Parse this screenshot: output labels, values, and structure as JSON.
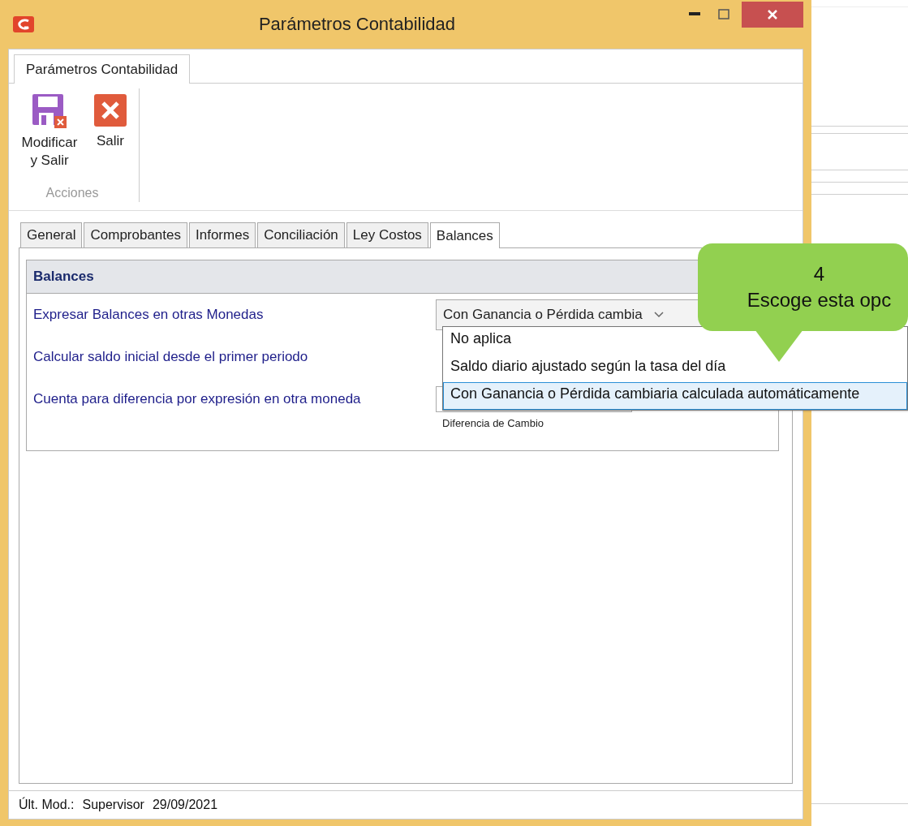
{
  "window": {
    "title": "Parámetros Contabilidad"
  },
  "ribbon": {
    "tab": "Parámetros Contabilidad",
    "buttons": [
      {
        "label": "Modificar y Salir",
        "kind": "save"
      },
      {
        "label": "Salir",
        "kind": "exit"
      }
    ],
    "group": "Acciones"
  },
  "tabs": [
    {
      "label": "General",
      "selected": false
    },
    {
      "label": "Comprobantes",
      "selected": false
    },
    {
      "label": "Informes",
      "selected": false
    },
    {
      "label": "Conciliación",
      "selected": false
    },
    {
      "label": "Ley Costos",
      "selected": false
    },
    {
      "label": "Balances",
      "selected": true
    }
  ],
  "section": {
    "title": "Balances",
    "rows": [
      {
        "label": "Expresar Balances en otras Monedas",
        "kind": "combo",
        "value": "Con Ganancia o Pérdida cambia"
      },
      {
        "label": "Calcular saldo inicial desde el primer periodo",
        "kind": "plain"
      },
      {
        "label": "Cuenta para diferencia por expresión en otra moneda",
        "kind": "account",
        "hint": "Diferencia de Cambio"
      }
    ]
  },
  "dropdown": {
    "options": [
      {
        "label": "No aplica",
        "selected": false
      },
      {
        "label": "Saldo diario ajustado según la tasa del día",
        "selected": false
      },
      {
        "label": "Con Ganancia o Pérdida cambiaria calculada automáticamente",
        "selected": true
      }
    ]
  },
  "callout": {
    "number": "4",
    "text": "Escoge esta opc"
  },
  "status_bar": {
    "label": "Últ. Mod.:",
    "user": "Supervisor",
    "date": "29/09/2021"
  }
}
